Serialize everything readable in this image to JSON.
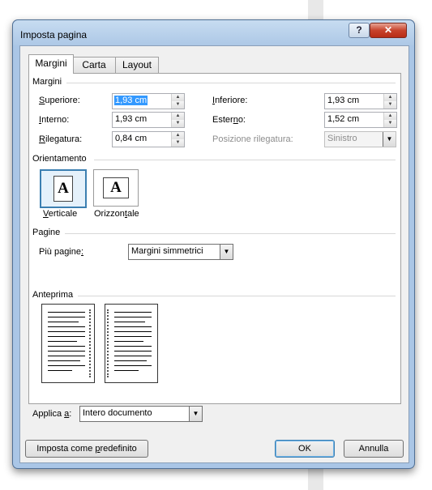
{
  "window": {
    "title": "Imposta pagina",
    "help_glyph": "?",
    "close_glyph": "✕"
  },
  "tabs": [
    {
      "label": "Margini"
    },
    {
      "label": "Carta"
    },
    {
      "label": "Layout"
    }
  ],
  "margins": {
    "section_label": "Margini",
    "top": {
      "label_u": "S",
      "label_rest": "uperiore:",
      "value": "1,93 cm"
    },
    "bottom": {
      "label_u": "I",
      "label_rest": "nferiore:",
      "value": "1,93 cm"
    },
    "inside": {
      "label_u": "I",
      "label_rest": "nterno:",
      "value": "1,93 cm"
    },
    "outside": {
      "label_pre": "Ester",
      "label_u": "n",
      "label_rest": "o:",
      "value": "1,52 cm"
    },
    "gutter": {
      "label_u": "R",
      "label_rest": "ilegatura:",
      "value": "0,84 cm"
    },
    "gutter_pos": {
      "label": "Posizione rilegatura:",
      "value": "Sinistro"
    }
  },
  "orientation": {
    "section_label": "Orientamento",
    "portrait": {
      "label_u": "V",
      "label_rest": "erticale",
      "glyph": "A"
    },
    "landscape": {
      "label_pre": "Orizzon",
      "label_u": "t",
      "label_rest": "ale",
      "glyph": "A"
    }
  },
  "pages": {
    "section_label": "Pagine",
    "multiple_label_pre": "Più pagine",
    "multiple_label_u": ":",
    "multiple_value": "Margini simmetrici"
  },
  "preview": {
    "section_label": "Anteprima"
  },
  "apply": {
    "label_pre": "Applica ",
    "label_u": "a",
    "label_rest": ":",
    "value": "Intero documento"
  },
  "buttons": {
    "default_pre": "Imposta come ",
    "default_u": "p",
    "default_rest": "redefinito",
    "ok": "OK",
    "cancel": "Annulla"
  },
  "icons": {
    "spin_up": "▲",
    "spin_down": "▼",
    "dropdown": "▼"
  }
}
